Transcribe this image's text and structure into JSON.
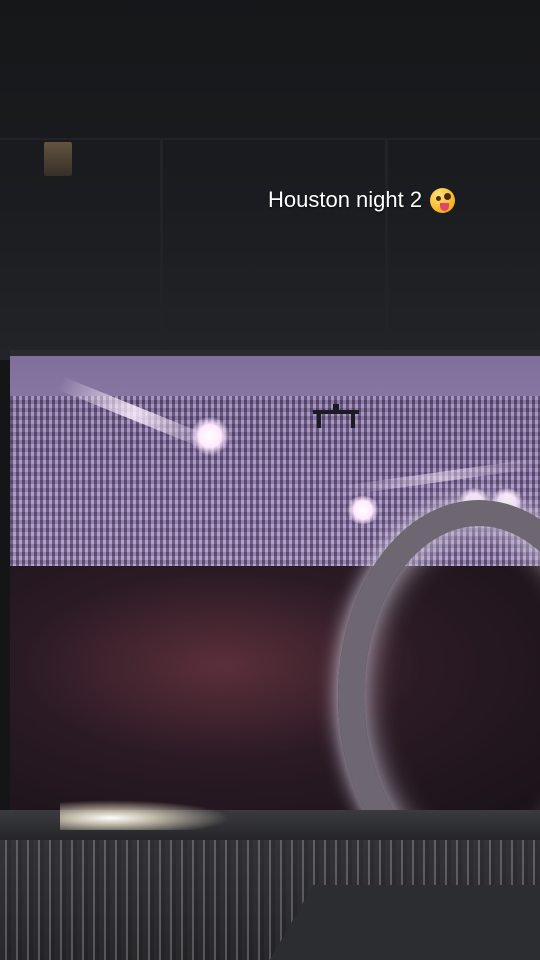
{
  "caption": {
    "text": "Houston night 2",
    "emoji": "zany-face-emoji"
  },
  "scene": {
    "description_icons": [
      "drone-icon",
      "stage-lights",
      "ring-structure"
    ],
    "colors": {
      "screen_purple": "#a894c0",
      "background": "#141517"
    }
  }
}
